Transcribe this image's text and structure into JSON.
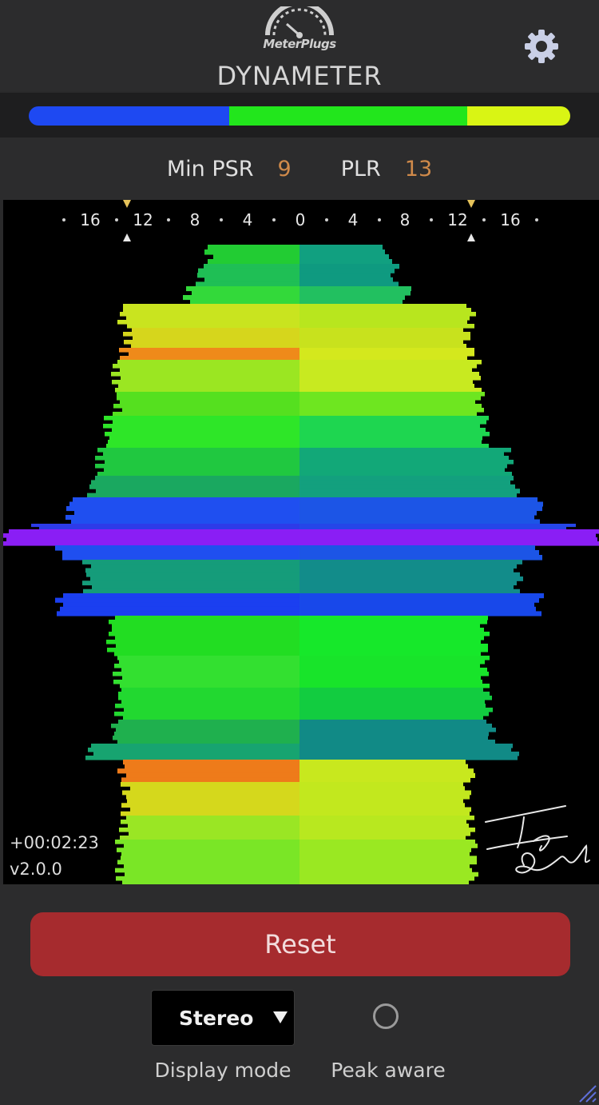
{
  "header": {
    "brand": "MeterPlugs",
    "title": "DYNAMETER",
    "settings_icon": "gear-icon"
  },
  "colors": {
    "gradient_blue": "#1e49f2",
    "gradient_green": "#22e61c",
    "gradient_yellow": "#d9f514",
    "reset_button": "#a62b2e",
    "stat_value": "#d08a4a"
  },
  "stats": {
    "min_psr_label": "Min PSR",
    "min_psr_value": "9",
    "plr_label": "PLR",
    "plr_value": "13"
  },
  "scale": {
    "labels": [
      "16",
      "12",
      "8",
      "4",
      "0",
      "4",
      "8",
      "12",
      "16"
    ]
  },
  "meter": {
    "timecode": "+00:02:23",
    "version": "v2.0.0"
  },
  "controls": {
    "reset_label": "Reset",
    "display_mode_value": "Stereo",
    "display_mode_label": "Display mode",
    "peak_aware_label": "Peak aware"
  }
}
